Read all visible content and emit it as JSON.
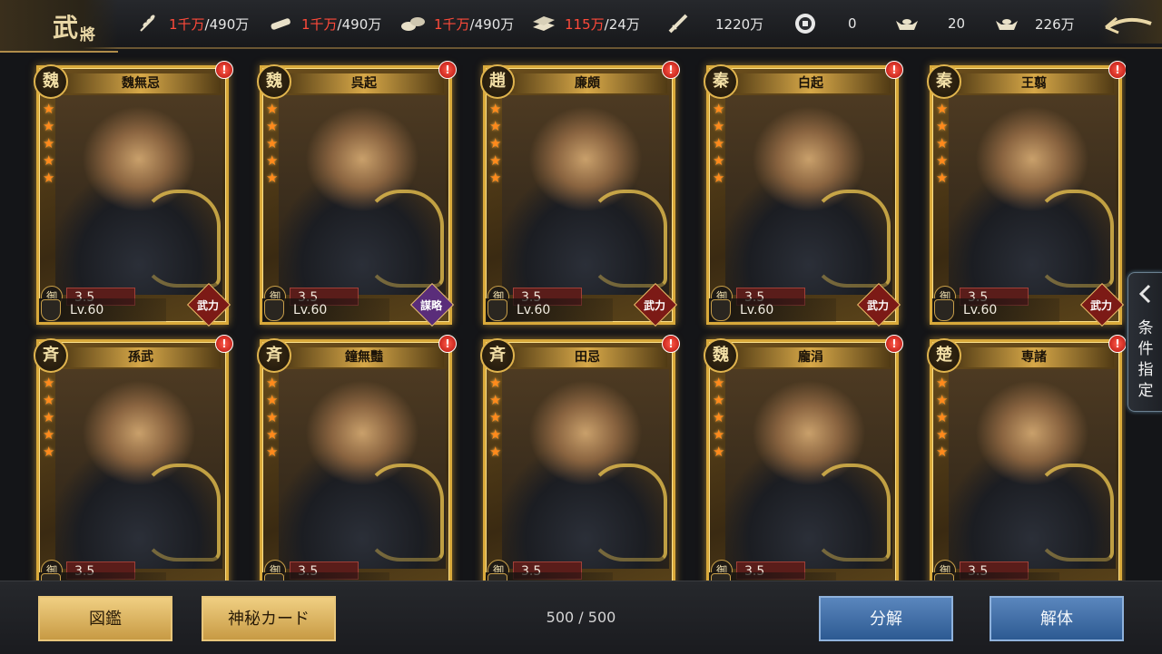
{
  "header": {
    "title": "武",
    "title_small": "將",
    "resources": [
      {
        "icon": "wheat-icon",
        "red": "1千万",
        "rest": "/490万"
      },
      {
        "icon": "wood-icon",
        "red": "1千万",
        "rest": "/490万"
      },
      {
        "icon": "stone-icon",
        "red": "1千万",
        "rest": "/490万"
      },
      {
        "icon": "iron-icon",
        "red": "115万",
        "rest": "/24万"
      },
      {
        "icon": "sword-icon",
        "red": "",
        "rest": "1220万"
      },
      {
        "icon": "coin-icon",
        "red": "",
        "rest": "0"
      },
      {
        "icon": "gold-ingot-icon",
        "red": "",
        "rest": "20"
      },
      {
        "icon": "silver-ingot-icon",
        "red": "",
        "rest": "226万"
      }
    ]
  },
  "cards": [
    {
      "nation": "魏",
      "name": "魏無忌",
      "stat_label": "御",
      "stat": "3.5",
      "level": "Lv.60",
      "type": "武力",
      "type_color": "red"
    },
    {
      "nation": "魏",
      "name": "呉起",
      "stat_label": "御",
      "stat": "3.5",
      "level": "Lv.60",
      "type": "謀略",
      "type_color": "purple"
    },
    {
      "nation": "趙",
      "name": "廉頗",
      "stat_label": "御",
      "stat": "3.5",
      "level": "Lv.60",
      "type": "武力",
      "type_color": "red"
    },
    {
      "nation": "秦",
      "name": "白起",
      "stat_label": "御",
      "stat": "3.5",
      "level": "Lv.60",
      "type": "武力",
      "type_color": "red"
    },
    {
      "nation": "秦",
      "name": "王翦",
      "stat_label": "御",
      "stat": "3.5",
      "level": "Lv.60",
      "type": "武力",
      "type_color": "red"
    },
    {
      "nation": "斉",
      "name": "孫武",
      "stat_label": "御",
      "stat": "3.5",
      "level": "",
      "type": "",
      "type_color": "red"
    },
    {
      "nation": "斉",
      "name": "鐘無豔",
      "stat_label": "御",
      "stat": "3.5",
      "level": "",
      "type": "",
      "type_color": "red"
    },
    {
      "nation": "斉",
      "name": "田忌",
      "stat_label": "御",
      "stat": "3.5",
      "level": "",
      "type": "",
      "type_color": "red"
    },
    {
      "nation": "魏",
      "name": "龐涓",
      "stat_label": "御",
      "stat": "3.5",
      "level": "",
      "type": "",
      "type_color": "red"
    },
    {
      "nation": "楚",
      "name": "専諸",
      "stat_label": "御",
      "stat": "3.5",
      "level": "",
      "type": "",
      "type_color": "red"
    }
  ],
  "alert_mark": "!",
  "star_char": "★",
  "side_tab": {
    "label": "条件指定"
  },
  "footer": {
    "zukan_label": "図鑑",
    "mystery_label": "神秘カード",
    "count": "500 / 500",
    "dismantle_label": "分解",
    "disband_label": "解体"
  }
}
